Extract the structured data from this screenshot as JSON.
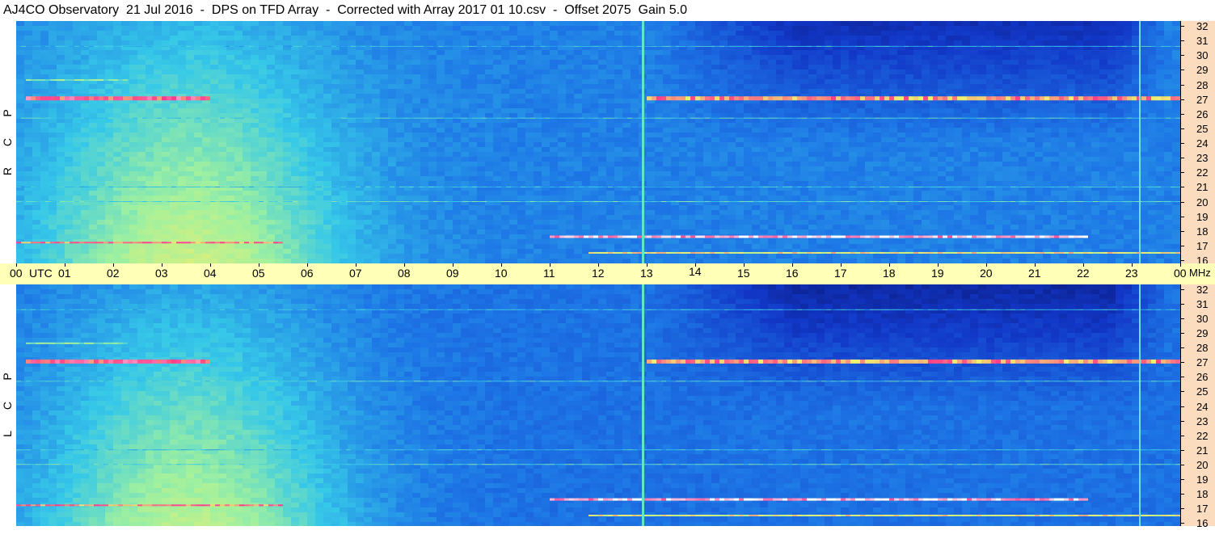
{
  "title": "AJ4CO Observatory  21 Jul 2016  -  DPS on TFD Array  -  Corrected with Array 2017 01 10.csv  -  Offset 2075  Gain 5.0",
  "chart_data": [
    {
      "type": "heatmap",
      "panel_label": [
        "R",
        "C",
        "P"
      ],
      "x_axis": {
        "label": "UTC",
        "ticks": [
          "00",
          "01",
          "02",
          "03",
          "04",
          "05",
          "06",
          "07",
          "08",
          "09",
          "10",
          "11",
          "12",
          "13",
          "14",
          "15",
          "16",
          "17",
          "18",
          "19",
          "20",
          "21",
          "22",
          "23",
          "00"
        ],
        "range": [
          0,
          24
        ]
      },
      "y_axis": {
        "label": "MHz",
        "ticks": [
          32,
          31,
          30,
          29,
          28,
          27,
          26,
          25,
          24,
          23,
          22,
          21,
          20,
          19,
          18,
          17,
          16
        ],
        "range": [
          16,
          32
        ]
      },
      "colormap": [
        "#0a1470",
        "#1238c8",
        "#1e78e6",
        "#36c8e8",
        "#9ef0a0",
        "#f0f070",
        "#ff3a8a",
        "#ffffff"
      ]
    },
    {
      "type": "heatmap",
      "panel_label": [
        "L",
        "C",
        "P"
      ],
      "x_axis": {
        "label": "UTC",
        "ticks": [
          "00",
          "01",
          "02",
          "03",
          "04",
          "05",
          "06",
          "07",
          "08",
          "09",
          "10",
          "11",
          "12",
          "13",
          "14",
          "15",
          "16",
          "17",
          "18",
          "19",
          "20",
          "21",
          "22",
          "23",
          "00"
        ],
        "range": [
          0,
          24
        ]
      },
      "y_axis": {
        "label": "MHz",
        "ticks": [
          32,
          31,
          30,
          29,
          28,
          27,
          26,
          25,
          24,
          23,
          22,
          21,
          20,
          19,
          18,
          17,
          16
        ],
        "range": [
          16,
          32
        ]
      },
      "colormap": [
        "#0a1470",
        "#1238c8",
        "#1e78e6",
        "#36c8e8",
        "#9ef0a0",
        "#f0f070",
        "#ff3a8a",
        "#ffffff"
      ]
    }
  ],
  "utc_label": "UTC",
  "mhz_label": "MHz"
}
